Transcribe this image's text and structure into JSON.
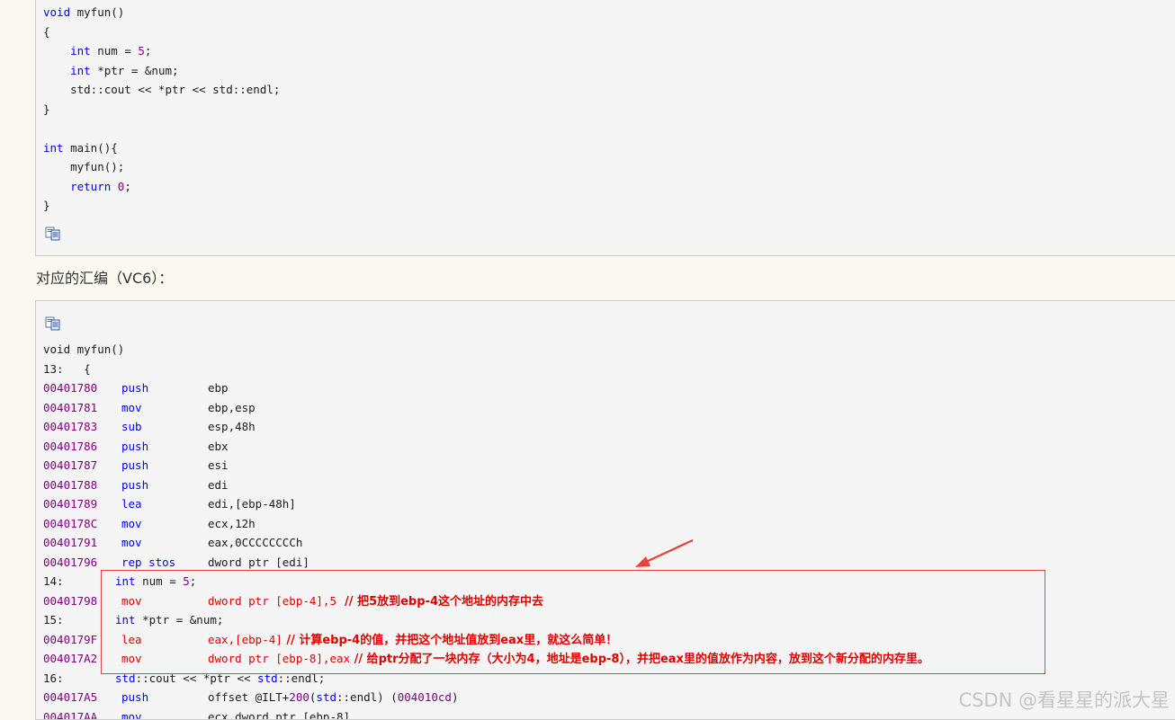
{
  "source_block": {
    "l1": [
      "void",
      " myfun()"
    ],
    "l2": "{",
    "l3": [
      "    ",
      "int",
      " num = ",
      "5",
      ";"
    ],
    "l4": [
      "    ",
      "int",
      " *ptr = &num;"
    ],
    "l5": "    std::cout << *ptr << std::endl;",
    "l6": "}",
    "l7": [
      "int",
      " main(){"
    ],
    "l8": "    myfun();",
    "l9": [
      "    ",
      "return",
      " ",
      "0",
      ";"
    ],
    "l10": "}"
  },
  "heading": "对应的汇编（VC6）：",
  "asm_block": {
    "header_l1": "void myfun()",
    "header_l2": "13:   {",
    "rows": [
      {
        "addr": "00401780",
        "op": "push",
        "arg": "ebp"
      },
      {
        "addr": "00401781",
        "op": "mov",
        "arg": "ebp,esp"
      },
      {
        "addr": "00401783",
        "op": "sub",
        "arg": "esp,48h"
      },
      {
        "addr": "00401786",
        "op": "push",
        "arg": "ebx"
      },
      {
        "addr": "00401787",
        "op": "push",
        "arg": "esi"
      },
      {
        "addr": "00401788",
        "op": "push",
        "arg": "edi"
      },
      {
        "addr": "00401789",
        "op": "lea",
        "arg": "edi,[ebp-48h]"
      },
      {
        "addr": "0040178C",
        "op": "mov",
        "arg": "ecx,12h"
      },
      {
        "addr": "00401791",
        "op": "mov",
        "arg": "eax,0CCCCCCCCh"
      },
      {
        "addr": "00401796",
        "op": "rep stos",
        "arg": "dword ptr [edi]"
      }
    ],
    "l14_label": "14:",
    "l14_src": [
      "int",
      " num = ",
      "5",
      ";"
    ],
    "r14_addr": "00401798",
    "r14_op": "mov",
    "r14_arg": "dword ptr [ebp-4],5",
    "r14_comment": "  // 把5放到ebp-4这个地址的内存中去",
    "l15_label": "15:",
    "l15_src": [
      "int",
      " *ptr = &num;"
    ],
    "r15a_addr": "0040179F",
    "r15a_op": "lea",
    "r15a_arg": "eax,[ebp-4]",
    "r15a_comment": " // 计算ebp-4的值，并把这个地址值放到eax里，就这么简单！",
    "r15b_addr": "004017A2",
    "r15b_op": "mov",
    "r15b_arg": "dword ptr [ebp-8],eax",
    "r15b_comment": " // 给ptr分配了一块内存（大小为4，地址是ebp-8），并把eax里的值放作为内容，放到这个新分配的内存里。",
    "l16_label": "16:",
    "l16_src": [
      "std",
      "::cout << *ptr << ",
      "std",
      "::endl;"
    ],
    "r16a_addr": "004017A5",
    "r16a_op": "push",
    "r16a_arg": [
      "offset @ILT+",
      "200",
      "(",
      "std",
      "::endl) (",
      "004010cd",
      ")"
    ],
    "r16b_addr": "004017AA",
    "r16b_op": "mov",
    "r16b_arg": "ecx,dword ptr [ebp-8]"
  },
  "watermark": "CSDN @看星星的派大星",
  "colors": {
    "keyword": "#0000ff",
    "number": "#800080",
    "annotation": "#e00000",
    "panel_bg": "#f5f5f5",
    "page_bg": "#faf8f1"
  },
  "icons": [
    "copy-code-icon",
    "annotation-arrow"
  ]
}
